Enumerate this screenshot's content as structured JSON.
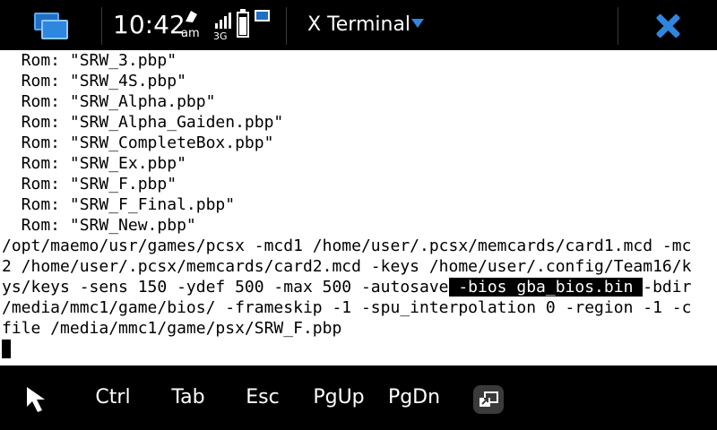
{
  "status": {
    "time": "10:42",
    "ampm": "am",
    "network": "3G"
  },
  "app": {
    "title": "X Terminal"
  },
  "terminal": {
    "lines": [
      "  Rom: \"SRW_3.pbp\"",
      "  Rom: \"SRW_4S.pbp\"",
      "  Rom: \"SRW_Alpha.pbp\"",
      "  Rom: \"SRW_Alpha_Gaiden.pbp\"",
      "  Rom: \"SRW_CompleteBox.pbp\"",
      "  Rom: \"SRW_Ex.pbp\"",
      "  Rom: \"SRW_F.pbp\"",
      "  Rom: \"SRW_F_Final.pbp\"",
      "  Rom: \"SRW_New.pbp\"",
      "/opt/maemo/usr/games/pcsx -mcd1 /home/user/.pcsx/memcards/card1.mcd -mc",
      "2 /home/user/.pcsx/memcards/card2.mcd -keys /home/user/.config/Team16/k"
    ],
    "line12_pre": "ys/keys -sens 150 -ydef 500 -max 500 -autosave",
    "line12_sel": " -bios gba_bios.bin ",
    "line12_post": "-bdir",
    "lines_after": [
      "/media/mmc1/game/bios/ -frameskip -1 -spu_interpolation 0 -region -1 -c",
      "file /media/mmc1/game/psx/SRW_F.pbp"
    ]
  },
  "toolbar": {
    "pointer_icon": "arrow-pointer-icon",
    "keys": [
      "Ctrl",
      "Tab",
      "Esc",
      "PgUp",
      "PgDn"
    ],
    "fullscreen_icon": "fullscreen-toggle-icon"
  },
  "colors": {
    "accent": "#2f86de",
    "terminal_bg": "#ffffff",
    "terminal_fg": "#000000",
    "chrome_bg": "#000000"
  }
}
